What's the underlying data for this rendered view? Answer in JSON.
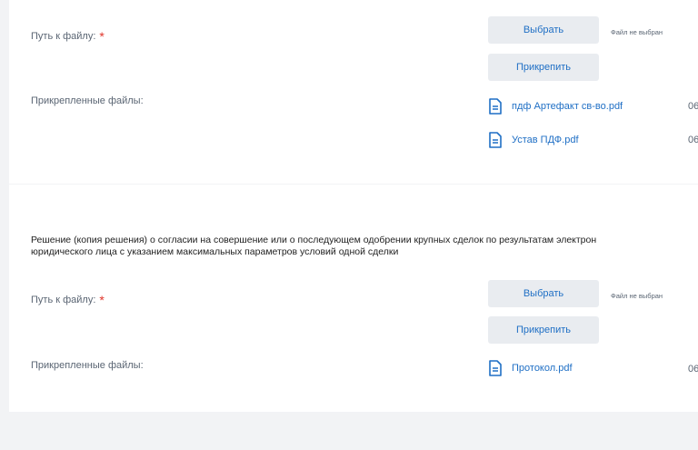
{
  "section1": {
    "path_label": "Путь к файлу:",
    "required_mark": "*",
    "choose_button": "Выбрать",
    "no_file_text": "Файл не выбран",
    "attach_button": "Прикрепить",
    "attached_label": "Прикрепленные файлы:",
    "files": [
      {
        "name": "пдф Артефакт св-во.pdf",
        "date": "06"
      },
      {
        "name": "Устав ПДФ.pdf",
        "date": "06"
      }
    ]
  },
  "section2": {
    "description_line1": "Решение (копия решения) о согласии на совершение или о последующем одобрении крупных сделок по результатам электрон",
    "description_line2": "юридического лица с указанием максимальных параметров условий одной сделки",
    "path_label": "Путь к файлу:",
    "required_mark": "*",
    "choose_button": "Выбрать",
    "no_file_text": "Файл не выбран",
    "attach_button": "Прикрепить",
    "attached_label": "Прикрепленные файлы:",
    "files": [
      {
        "name": "Протокол.pdf",
        "date": "06"
      }
    ]
  },
  "colors": {
    "link": "#1f6fc5",
    "required": "#e0352b",
    "button_bg": "#e9ecf0",
    "page_bg": "#f2f3f5"
  },
  "icons": {
    "file": "document-icon"
  }
}
